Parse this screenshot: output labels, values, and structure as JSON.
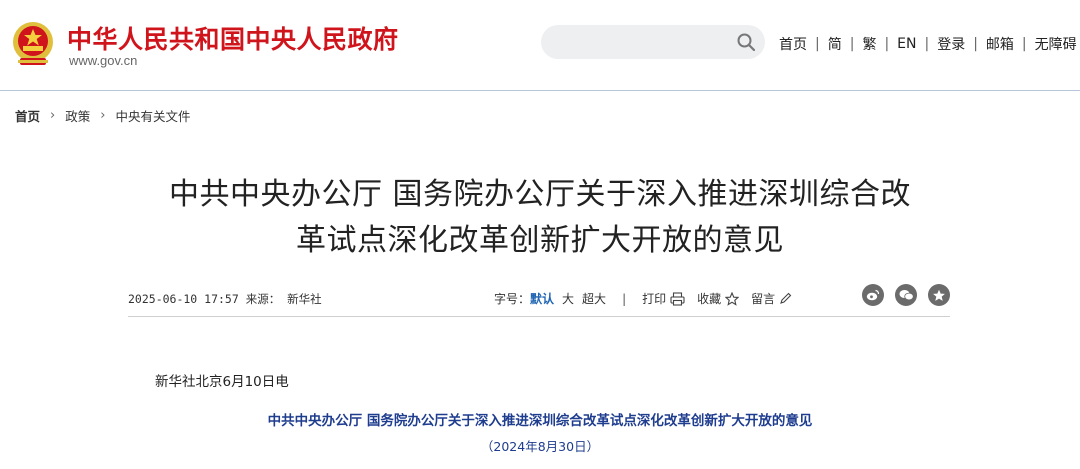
{
  "header": {
    "site_title": "中华人民共和国中央人民政府",
    "site_domain": "www.gov.cn",
    "search": {
      "placeholder": ""
    },
    "nav": [
      "首页",
      "简",
      "繁",
      "EN",
      "登录",
      "邮箱",
      "无障碍"
    ]
  },
  "breadcrumb": [
    "首页",
    "政策",
    "中央有关文件"
  ],
  "article": {
    "title_line1": "中共中央办公厅 国务院办公厅关于深入推进深圳综合改",
    "title_line2": "革试点深化改革创新扩大开放的意见",
    "datetime": "2025-06-10 17:57",
    "source_label": "来源：",
    "source": "新华社",
    "font_size_label": "字号：",
    "font_size_options": [
      "默认",
      "大",
      "超大"
    ],
    "font_size_selected": "默认",
    "print_label": "打印",
    "favorite_label": "收藏",
    "comment_label": "留言",
    "share_icons": [
      "weibo-icon",
      "wechat-icon",
      "qzone-icon"
    ],
    "dateline": "新华社北京6月10日电",
    "doc_title": "中共中央办公厅  国务院办公厅关于深入推进深圳综合改革试点深化改革创新扩大开放的意见",
    "doc_date": "（2024年8月30日）"
  },
  "colors": {
    "brand_red": "#d0141c",
    "link_blue": "#2165b3",
    "doc_blue": "#1f3d8f"
  }
}
